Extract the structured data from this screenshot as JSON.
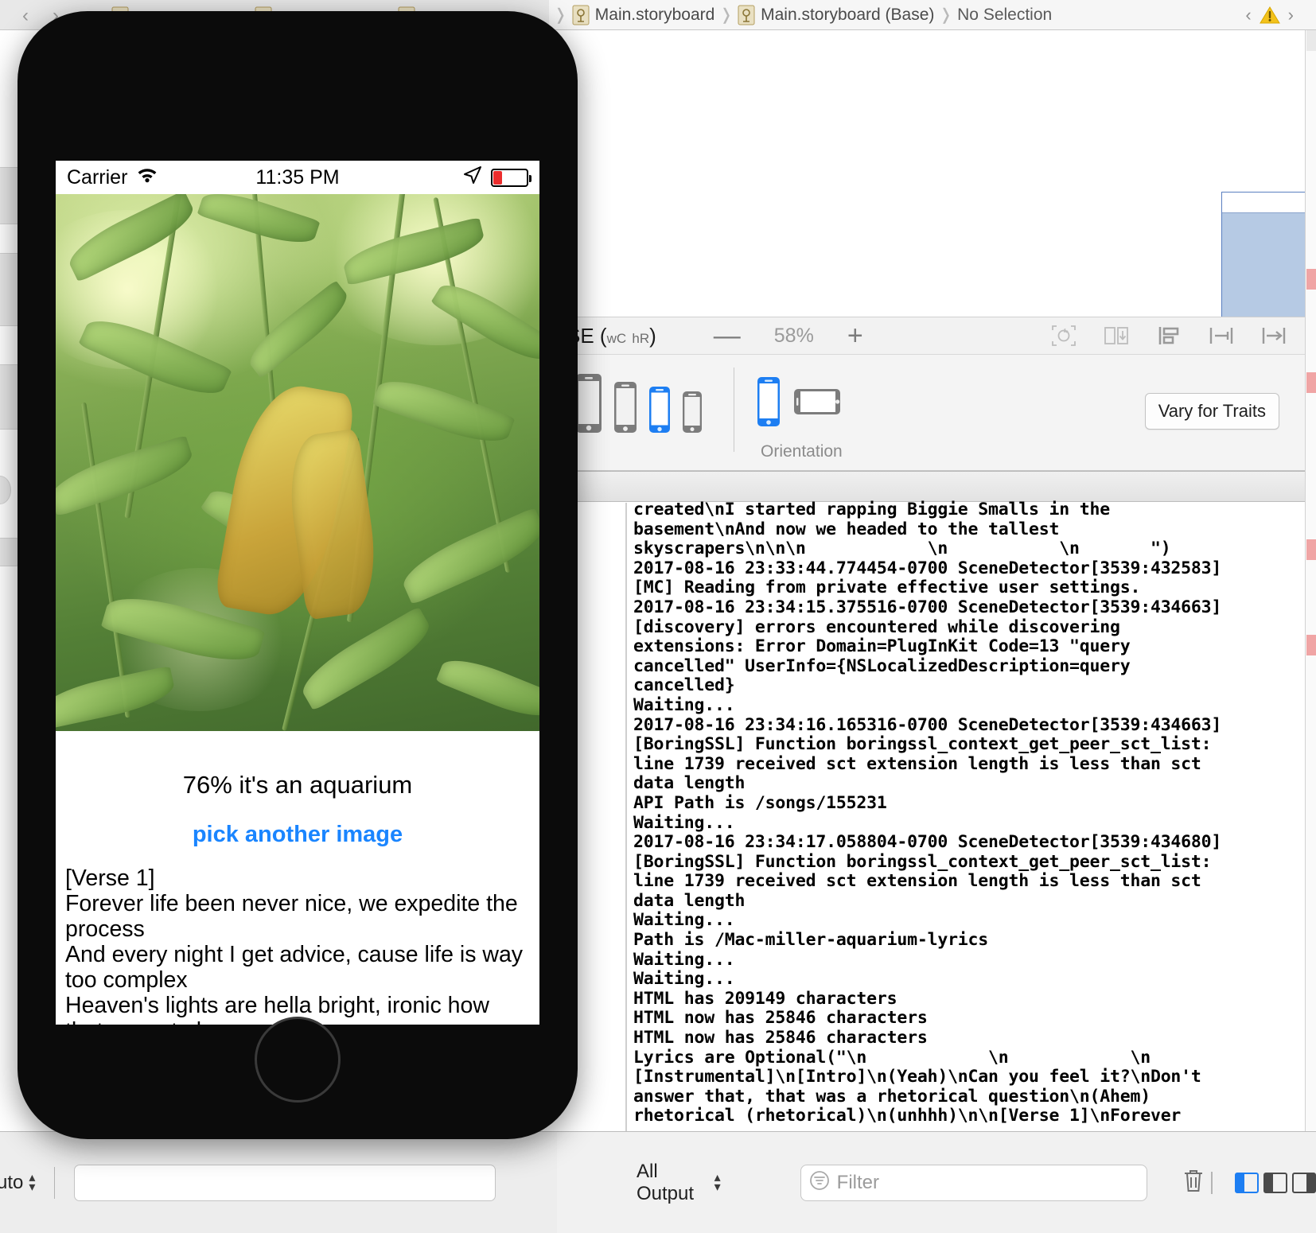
{
  "xcode": {
    "breadcrumb": [
      {
        "icon": "storyboard-file-icon",
        "label": "Main.storyboard"
      },
      {
        "icon": "storyboard-file-icon",
        "label": "Main.storyboard (Base)"
      },
      {
        "icon": "",
        "label": "No Selection"
      }
    ],
    "nav_prev_label": "‹",
    "nav_next_label": "›",
    "warning_icon": "warning-triangle-icon",
    "canvas": {
      "trait_label_main": "SE (",
      "trait_label_wc": "wC",
      "trait_label_hr": "hR",
      "trait_label_close": ")",
      "zoom_out_label": "—",
      "zoom_level": "58%",
      "zoom_in_label": "+",
      "tool_icons": [
        "update-frames-icon",
        "embed-in-icon",
        "align-icon",
        "pin-icon",
        "resolve-issues-icon"
      ]
    },
    "devicebar": {
      "device_sizes": [
        "device-size-55in",
        "device-size-47in",
        "device-size-40in",
        "device-size-35in"
      ],
      "selected_device_index": 2,
      "orientation_caption": "Orientation",
      "orientation_options": [
        "portrait-icon",
        "landscape-icon"
      ],
      "selected_orientation_index": 0,
      "vary_for_traits_label": "Vary for Traits"
    },
    "console": {
      "lines": "created\\nI started rapping Biggie Smalls in the\nbasement\\nAnd now we headed to the tallest\nskyscrapers\\n\\n\\n            \\n           \\n       \")\n2017-08-16 23:33:44.774454-0700 SceneDetector[3539:432583]\n[MC] Reading from private effective user settings.\n2017-08-16 23:34:15.375516-0700 SceneDetector[3539:434663]\n[discovery] errors encountered while discovering\nextensions: Error Domain=PlugInKit Code=13 \"query\ncancelled\" UserInfo={NSLocalizedDescription=query\ncancelled}\nWaiting...\n2017-08-16 23:34:16.165316-0700 SceneDetector[3539:434663]\n[BoringSSL] Function boringssl_context_get_peer_sct_list:\nline 1739 received sct extension length is less than sct\ndata length\nAPI Path is /songs/155231\nWaiting...\n2017-08-16 23:34:17.058804-0700 SceneDetector[3539:434680]\n[BoringSSL] Function boringssl_context_get_peer_sct_list:\nline 1739 received sct extension length is less than sct\ndata length\nWaiting...\nPath is /Mac-miller-aquarium-lyrics\nWaiting...\nWaiting...\nHTML has 209149 characters\nHTML now has 25846 characters\nHTML now has 25846 characters\nLyrics are Optional(\"\\n            \\n            \\n\n[Instrumental]\\n[Intro]\\n(Yeah)\\nCan you feel it?\\nDon't\nanswer that, that was a rhetorical question\\n(Ahem)\nrhetorical (rhetorical)\\n(unhhh)\\n\\n[Verse 1]\\nForever",
      "bottom": {
        "scope_label": "All Output",
        "filter_placeholder": "Filter",
        "filter_icon": "filter-icon",
        "trash_icon": "trash-icon",
        "pane_toggle_icons": [
          "show-left-pane-icon",
          "show-both-panes-icon",
          "show-right-pane-icon"
        ]
      }
    },
    "nav_footer": {
      "auto_label": "uto",
      "stepper_icon": "stepper-icon"
    }
  },
  "simulator": {
    "statusbar": {
      "carrier": "Carrier",
      "wifi_icon": "wifi-icon",
      "time": "11:35 PM",
      "location_icon": "location-arrow-icon",
      "battery_icon": "battery-low-icon"
    },
    "photo_alt": "green-leaves-photo",
    "result_text": "76% it's an aquarium",
    "pick_another_label": "pick another image",
    "lyrics": "[Verse 1]\nForever life been never nice, we expedite the process\nAnd every night I get advice, cause life is way too complex\nHeaven's lights are hella bright, ironic how that came to be",
    "home_button": "home-button"
  },
  "colors": {
    "accent_blue": "#1a85ff",
    "ib_selection": "#b6cae4",
    "battery_red": "#ec2d2d"
  }
}
